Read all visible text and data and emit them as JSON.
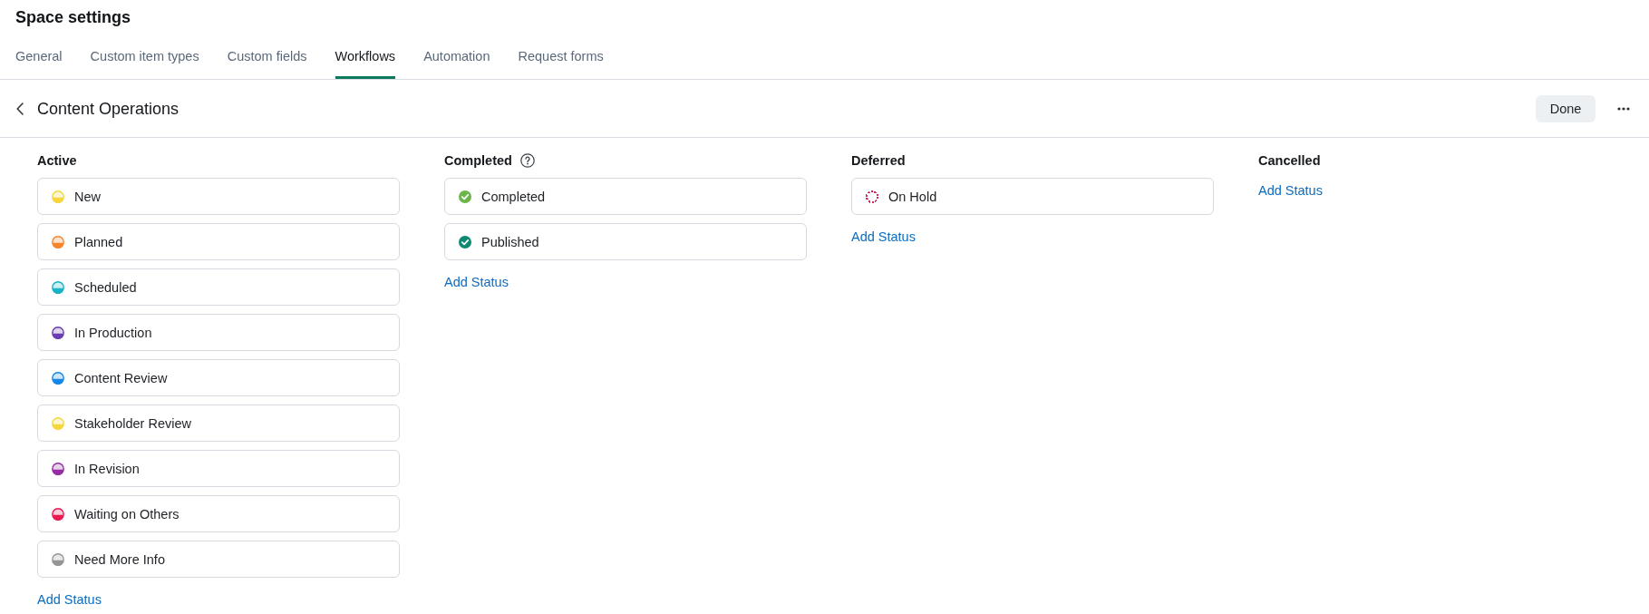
{
  "page": {
    "title": "Space settings"
  },
  "tabs": [
    {
      "label": "General",
      "selected": false
    },
    {
      "label": "Custom item types",
      "selected": false
    },
    {
      "label": "Custom fields",
      "selected": false
    },
    {
      "label": "Workflows",
      "selected": true
    },
    {
      "label": "Automation",
      "selected": false
    },
    {
      "label": "Request forms",
      "selected": false
    }
  ],
  "header": {
    "title": "Content Operations",
    "done_button": "Done"
  },
  "columns": [
    {
      "title": "Active",
      "help": false,
      "statuses": [
        {
          "name": "New",
          "kind": "progress",
          "color": "#f5d63d"
        },
        {
          "name": "Planned",
          "kind": "progress",
          "color": "#f5862e"
        },
        {
          "name": "Scheduled",
          "kind": "progress",
          "color": "#17b3c6"
        },
        {
          "name": "In Production",
          "kind": "progress",
          "color": "#6a3db0"
        },
        {
          "name": "Content Review",
          "kind": "progress",
          "color": "#1788e6"
        },
        {
          "name": "Stakeholder Review",
          "kind": "progress",
          "color": "#f5d63d"
        },
        {
          "name": "In Revision",
          "kind": "progress",
          "color": "#952ea3"
        },
        {
          "name": "Waiting on Others",
          "kind": "progress",
          "color": "#ea1a53"
        },
        {
          "name": "Need More Info",
          "kind": "progress",
          "color": "#959595"
        }
      ],
      "add_label": "Add Status"
    },
    {
      "title": "Completed",
      "help": true,
      "statuses": [
        {
          "name": "Completed",
          "kind": "complete",
          "color": "#6ab64b"
        },
        {
          "name": "Published",
          "kind": "complete",
          "color": "#0e8a72"
        }
      ],
      "add_label": "Add Status"
    },
    {
      "title": "Deferred",
      "help": false,
      "statuses": [
        {
          "name": "On Hold",
          "kind": "deferred",
          "color": "#d2285e"
        }
      ],
      "add_label": "Add Status"
    },
    {
      "title": "Cancelled",
      "help": false,
      "add_label": "Add Status"
    }
  ]
}
